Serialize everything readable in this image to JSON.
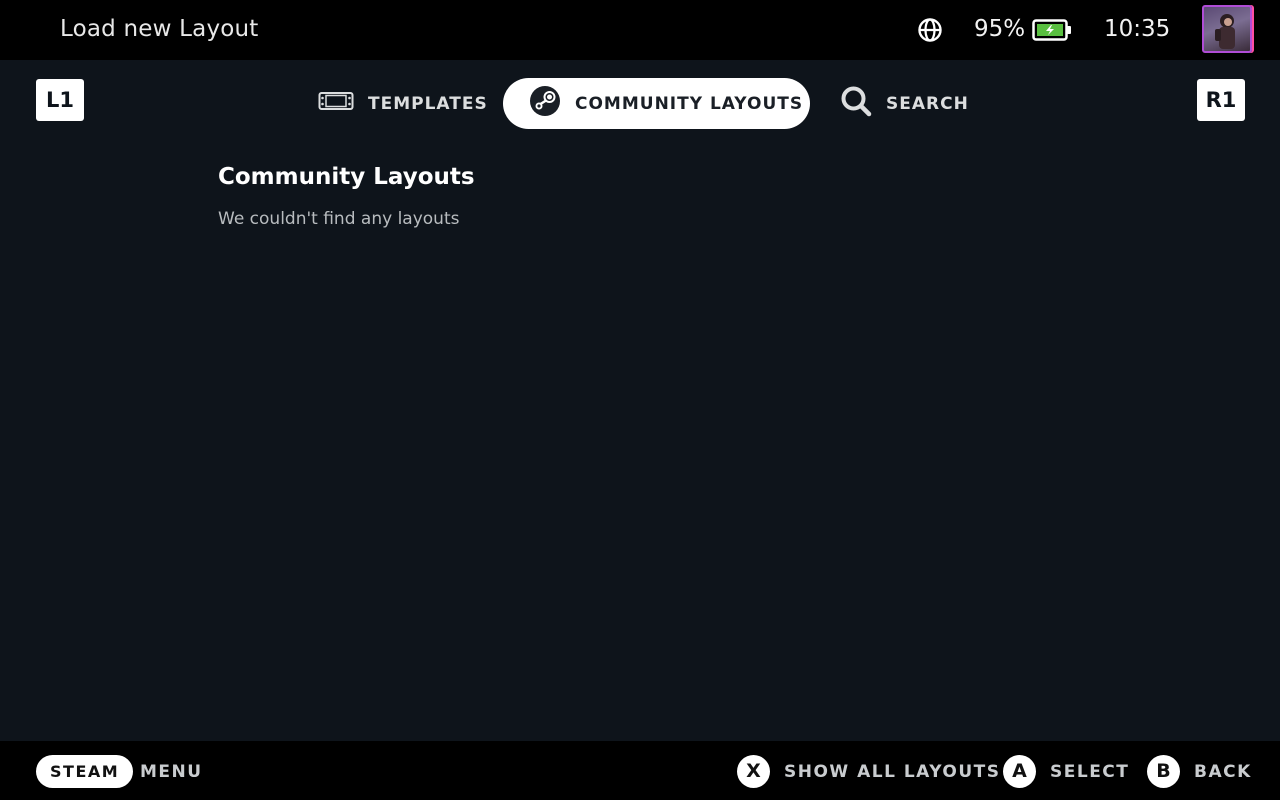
{
  "header": {
    "title": "Load new Layout",
    "battery_percent": "95%",
    "time": "10:35",
    "icons": [
      "globe-icon",
      "battery-charging-icon",
      "avatar"
    ]
  },
  "shoulders": {
    "left": "L1",
    "right": "R1"
  },
  "tabs": [
    {
      "label": "TEMPLATES",
      "icon": "controller-icon",
      "active": false
    },
    {
      "label": "COMMUNITY LAYOUTS",
      "icon": "steam-icon",
      "active": true
    },
    {
      "label": "SEARCH",
      "icon": "search-icon",
      "active": false
    }
  ],
  "content": {
    "heading": "Community Layouts",
    "message": "We couldn't find any layouts"
  },
  "footer": {
    "steam_label": "STEAM",
    "menu_label": "MENU",
    "hints": [
      {
        "button": "X",
        "label": "SHOW ALL LAYOUTS"
      },
      {
        "button": "A",
        "label": "SELECT"
      },
      {
        "button": "B",
        "label": "BACK"
      }
    ]
  },
  "colors": {
    "background": "#0e141b",
    "bar": "#000000",
    "battery_green": "#59bf40",
    "avatar_border": "#b04dd6"
  }
}
